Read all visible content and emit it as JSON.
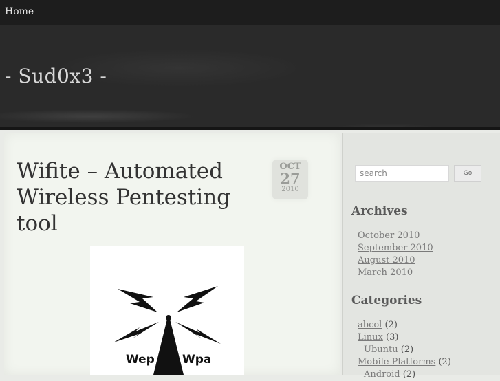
{
  "nav": {
    "home_label": "Home"
  },
  "site": {
    "title": "- Sud0x3 -"
  },
  "post": {
    "title": "Wifite – Automated Wireless Pentesting tool",
    "date": {
      "month": "OCT",
      "day": "27",
      "year": "2010"
    },
    "image_labels": {
      "left": "Wep",
      "right": "Wpa"
    }
  },
  "sidebar": {
    "search": {
      "placeholder": "search",
      "button_label": "Go"
    },
    "archives": {
      "title": "Archives",
      "items": [
        "October 2010",
        "September 2010",
        "August 2010",
        "March 2010"
      ]
    },
    "categories": {
      "title": "Categories",
      "items": [
        {
          "name": "abcol",
          "count": "(2)"
        },
        {
          "name": "Linux",
          "count": "(3)"
        },
        {
          "name": "Ubuntu",
          "count": "(2)"
        },
        {
          "name": "Mobile Platforms",
          "count": "(2)"
        },
        {
          "name": "Android",
          "count": "(2)"
        }
      ]
    }
  },
  "colors": {
    "topbar": "#1d1d1d",
    "header": "#2a2a2a",
    "content_bg": "#f2f5ef",
    "sidebar_bg": "#e3e5e1"
  }
}
